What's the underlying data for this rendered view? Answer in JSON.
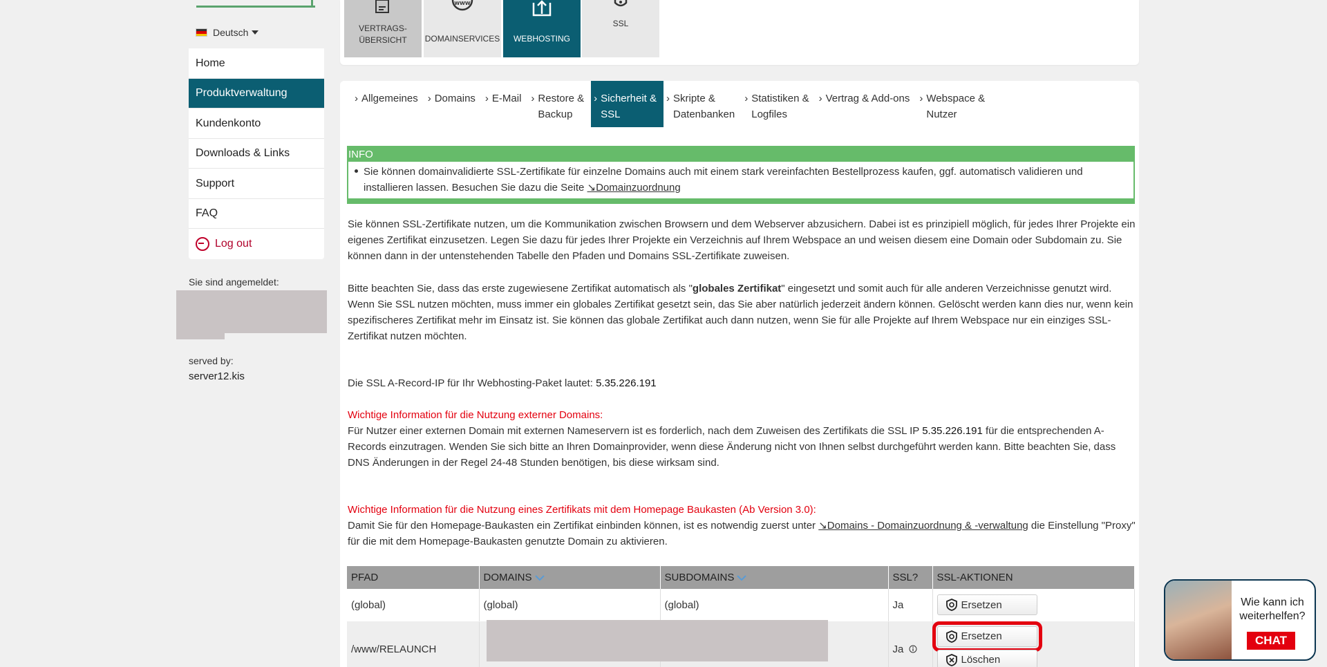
{
  "sidebar": {
    "language": "Deutsch",
    "menu": [
      {
        "label": "Home"
      },
      {
        "label": "Produktverwaltung"
      },
      {
        "label": "Kundenkonto"
      },
      {
        "label": "Downloads & Links"
      },
      {
        "label": "Support"
      },
      {
        "label": "FAQ"
      },
      {
        "label": "Log out"
      }
    ],
    "logged_in_label": "Sie sind angemeldet:",
    "served_by_label": "served by:",
    "served_by_value": "server12.kis"
  },
  "product_tabs": [
    {
      "label": "VERTRAGS-\nÜBERSICHT"
    },
    {
      "label": "DOMAINSERVICES"
    },
    {
      "label": "WEBHOSTING"
    },
    {
      "label": "SSL"
    }
  ],
  "sub_tabs": [
    {
      "line1": "Allgemeines",
      "line2": ""
    },
    {
      "line1": "Domains",
      "line2": ""
    },
    {
      "line1": "E-Mail",
      "line2": ""
    },
    {
      "line1": "Restore &",
      "line2": "Backup"
    },
    {
      "line1": "Sicherheit &",
      "line2": "SSL"
    },
    {
      "line1": "Skripte &",
      "line2": "Datenbanken"
    },
    {
      "line1": "Statistiken &",
      "line2": "Logfiles"
    },
    {
      "line1": "Vertrag & Add-ons",
      "line2": ""
    },
    {
      "line1": "Webspace &",
      "line2": "Nutzer"
    }
  ],
  "info": {
    "title": "INFO",
    "text": "Sie können domainvalidierte SSL-Zertifikate für einzelne Domains auch mit einem stark vereinfachten Bestellprozess kaufen, ggf. automatisch validieren und installieren lassen. Besuchen Sie dazu die Seite ",
    "link": "↘Domainzuordnung"
  },
  "content": {
    "p1": "Sie können SSL-Zertifikate nutzen, um die Kommunikation zwischen Browsern und dem Webserver abzusichern. Dabei ist es prinzipiell möglich, für jedes Ihrer Projekte ein eigenes Zertifikat einzusetzen. Legen Sie dazu für jedes Ihrer Projekte ein Verzeichnis auf Ihrem Webspace an und weisen diesem eine Domain oder Subdomain zu. Sie können dann in der untenstehenden Tabelle den Pfaden und Domains SSL-Zertifikate zuweisen.",
    "p2_a": "Bitte beachten Sie, dass das erste zugewiesene Zertifikat automatisch als \"",
    "p2_bold": "globales Zertifikat",
    "p2_b": "\" eingesetzt und somit auch für alle anderen Verzeichnisse genutzt wird. Wenn Sie SSL nutzen möchten, muss immer ein globales Zertifikat gesetzt sein, das Sie aber natürlich jederzeit ändern können. Gelöscht werden kann dies nur, wenn kein spezifischeres Zertifikat mehr im Einsatz ist. Sie können das globale Zertifikat auch dann nutzen, wenn Sie für alle Projekte auf Ihrem Webspace nur ein einziges SSL-Zertifikat nutzen möchten.",
    "ip_label": "Die SSL A-Record-IP für Ihr Webhosting-Paket lautet: ",
    "ip_value": "5.35.226.191",
    "ext_title": "Wichtige Information für die Nutzung externer Domains:",
    "ext_a": "Für Nutzer einer externen Domain mit externen Nameservern ist es forderlich, nach dem Zuweisen des Zertifikats die SSL IP ",
    "ext_ip": "5.35.226.191",
    "ext_b": " für die entsprechenden A-Records einzutragen. Wenden Sie sich bitte an Ihren Domainprovider, wenn diese Änderung nicht von Ihnen selbst durchgeführt werden kann. Bitte beachten Sie, dass DNS Änderungen in der Regel 24-48 Stunden benötigen, bis diese wirksam sind.",
    "hp_title": "Wichtige Information für die Nutzung eines Zertifikats mit dem Homepage Baukasten (Ab Version 3.0):",
    "hp_a": "Damit Sie für den Homepage-Baukasten ein Zertifikat einbinden können, ist es notwendig zuerst unter ",
    "hp_link": "↘Domains - Domainzuordnung & -verwaltung",
    "hp_b": " die Einstellung \"Proxy\" für die mit dem Homepage-Baukasten genutzte Domain zu aktivieren."
  },
  "table": {
    "headers": [
      "PFAD",
      "DOMAINS",
      "SUBDOMAINS",
      "SSL?",
      "SSL-AKTIONEN"
    ],
    "rows": [
      {
        "pfad": "(global)",
        "domains": "(global)",
        "subdomains": "(global)",
        "ssl": "Ja",
        "action1": "Ersetzen",
        "action2": ""
      },
      {
        "pfad": "/www/RELAUNCH",
        "domains": "",
        "subdomains": "",
        "ssl": "Ja",
        "action1": "Ersetzen",
        "action2": "Löschen"
      }
    ]
  },
  "chat": {
    "text": "Wie kann ich weiterhelfen?",
    "button": "CHAT"
  },
  "colors": {
    "primary": "#0b5e72",
    "info_green": "#66bb6a",
    "alert_red": "#e3000f"
  }
}
